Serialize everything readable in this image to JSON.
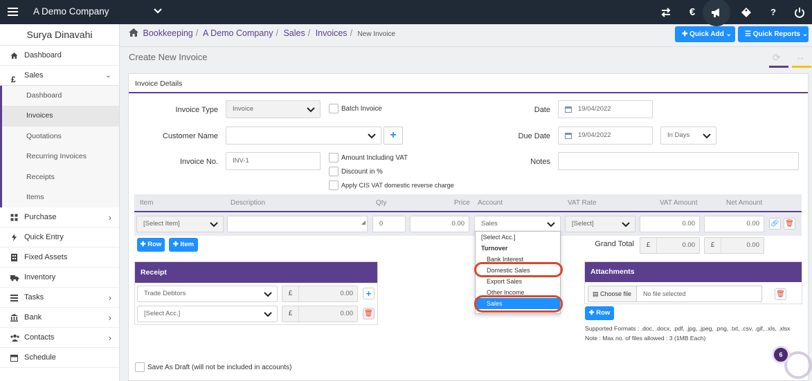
{
  "topbar": {
    "company": "A Demo Company",
    "bg": "#1f2a36"
  },
  "user": {
    "name": "Surya Dinavahi"
  },
  "sidebar": {
    "items": [
      {
        "label": "Dashboard",
        "icon": "dashboard-icon"
      },
      {
        "label": "Sales",
        "icon": "pound-icon"
      },
      {
        "label": "Purchase",
        "icon": "purchase-icon"
      },
      {
        "label": "Quick Entry",
        "icon": "bolt-icon"
      },
      {
        "label": "Fixed Assets",
        "icon": "building-icon"
      },
      {
        "label": "Inventory",
        "icon": "truck-icon"
      },
      {
        "label": "Tasks",
        "icon": "tasks-icon"
      },
      {
        "label": "Bank",
        "icon": "bank-icon"
      },
      {
        "label": "Contacts",
        "icon": "users-icon"
      },
      {
        "label": "Schedule",
        "icon": "calendar-icon"
      }
    ],
    "sales_sub": [
      "Dashboard",
      "Invoices",
      "Quotations",
      "Recurring Invoices",
      "Receipts",
      "Items"
    ]
  },
  "breadcrumb": {
    "items": [
      "Bookkeeping",
      "A Demo Company",
      "Sales",
      "Invoices"
    ],
    "current": "New Invoice"
  },
  "quick": {
    "add": "Quick Add",
    "reports": "Quick Reports"
  },
  "page_title": "Create New Invoice",
  "invoice": {
    "section": "Invoice Details",
    "type_label": "Invoice Type",
    "type_value": "Invoice",
    "batch_label": "Batch Invoice",
    "customer_label": "Customer Name",
    "number_label": "Invoice No.",
    "number_value": "INV-1",
    "amount_vat": "Amount Including VAT",
    "discount": "Discount in %",
    "cis": "Apply CIS VAT domestic reverse charge",
    "date_label": "Date",
    "date_value": "19/04/2022",
    "due_label": "Due Date",
    "due_value": "19/04/2022",
    "due_mode": "In Days",
    "notes_label": "Notes"
  },
  "table": {
    "headers": [
      "Item",
      "Description",
      "Qty",
      "Price",
      "Account",
      "VAT Rate",
      "VAT Amount",
      "Net Amount"
    ],
    "row": {
      "item": "[Select Item]",
      "qty": "0",
      "price": "0.00",
      "account": "Sales",
      "vat": "[Select]",
      "vat_amount": "0.00",
      "net_amount": "0.00"
    }
  },
  "buttons": {
    "row": "Row",
    "item": "Item",
    "attach_row": "Row"
  },
  "grand_total": {
    "label": "Grand Total",
    "currency": "£",
    "vat": "0.00",
    "net": "0.00"
  },
  "receipt": {
    "title": "Receipt",
    "rows": [
      {
        "account": "Trade Debtors",
        "currency": "£",
        "amount": "0.00"
      },
      {
        "account": "[Select Acc.]",
        "currency": "£",
        "amount": "0.00"
      }
    ]
  },
  "account_dropdown": {
    "options": [
      "[Select Acc.]",
      "Turnover",
      "Bank Interest",
      "Domestic Sales",
      "Export Sales",
      "Other Income",
      "Sales"
    ],
    "selected": "Sales"
  },
  "attachments": {
    "title": "Attachments",
    "choose": "Choose file",
    "none": "No file selected",
    "formats": "Supported Formats : .doc, .docx, .pdf, .jpg, .jpeg, .png, .txt, .csv, .gif, .xls, .xlsx",
    "max": "Note : Max no. of files allowed : 3 (1MB Each)"
  },
  "draft": "Save As Draft (will not be included in accounts)",
  "badge": "6",
  "colors": {
    "accent": "#5b3f8c",
    "primary": "#1e90ff",
    "highlight": "#d9472b"
  }
}
